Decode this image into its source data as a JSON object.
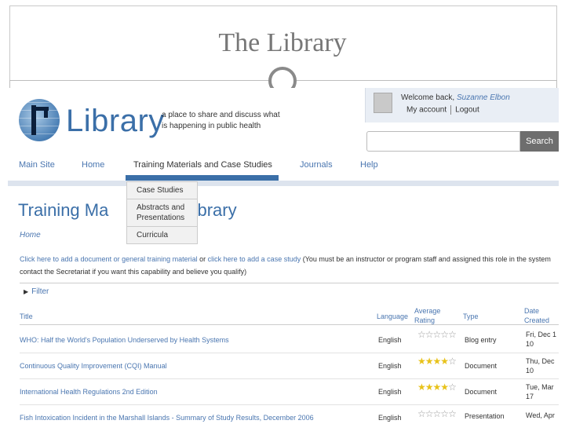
{
  "slide": {
    "title": "The Library"
  },
  "site": {
    "logo_text": "Library",
    "tagline": "a place to share and discuss what is happening in public health",
    "welcome_prefix": "Welcome back,",
    "user_name": "Suzanne Elbon",
    "my_account": "My account",
    "logout": "Logout",
    "search_placeholder": "",
    "search_button": "Search"
  },
  "nav": {
    "items": [
      "Main Site",
      "Home",
      "Training Materials and Case Studies",
      "Journals",
      "Help"
    ],
    "active": "Training Materials and Case Studies"
  },
  "dropdown": {
    "items": [
      "Case Studies",
      "Abstracts and Presentations",
      "Curricula"
    ]
  },
  "main": {
    "title_left": "Training Ma",
    "title_right": "Library",
    "breadcrumb": "Home",
    "notice_link1": "Click here to add a document or general training material",
    "notice_mid": " or ",
    "notice_link2": "click here to add a case study",
    "notice_tail": " (You must be an instructor or program staff and assigned this role in the system",
    "notice_line2": "contact the Secretariat if you want this capability and believe you qualify)",
    "filter_label": "Filter"
  },
  "table": {
    "headers": {
      "title": "Title",
      "language": "Language",
      "rating": "Average Rating",
      "type": "Type",
      "date": "Date Created"
    },
    "rows": [
      {
        "title": "WHO: Half the World's Population Underserved by Health Systems",
        "language": "English",
        "stars": 0,
        "type": "Blog entry",
        "date": "Fri, Dec 1\n10"
      },
      {
        "title": "Continuous Quality Improvement (CQI) Manual",
        "language": "English",
        "stars": 4,
        "type": "Document",
        "date": "Thu, Dec\n10"
      },
      {
        "title": "International Health Regulations 2nd Edition",
        "language": "English",
        "stars": 4,
        "type": "Document",
        "date": "Tue, Mar\n17"
      },
      {
        "title": "Fish Intoxication Incident in the Marshall Islands - Summary of Study Results, December 2006",
        "language": "English",
        "stars": 0,
        "type": "Presentation",
        "date": "Wed, Apr"
      }
    ]
  },
  "colors": {
    "accent": "#3b6fa8",
    "link": "#4a76b0",
    "star": "#e8c21a"
  }
}
